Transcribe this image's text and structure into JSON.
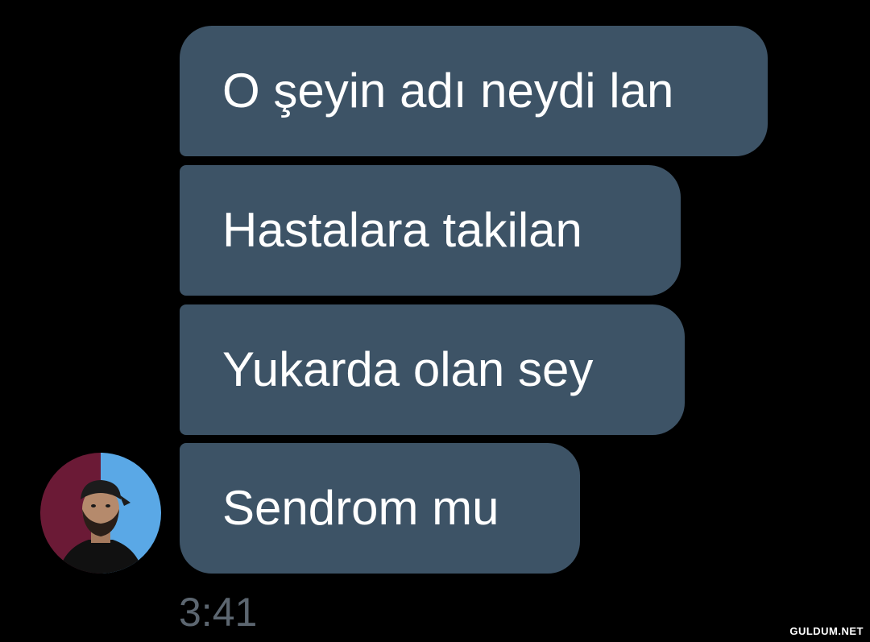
{
  "chat": {
    "messages": [
      {
        "text": "O şeyin adı neydi lan"
      },
      {
        "text": "Hastalara takilan"
      },
      {
        "text": "Yukarda olan sey"
      },
      {
        "text": "Sendrom mu"
      }
    ],
    "timestamp": "3:41",
    "avatar": {
      "icon": "user-avatar-photo"
    }
  },
  "watermark": "GULDUM.NET",
  "colors": {
    "background": "#000000",
    "bubble": "#3d5366",
    "bubble_text": "#ffffff",
    "timestamp": "#5c6670",
    "avatar_left": "#6b1a36",
    "avatar_right": "#5aa8e6"
  }
}
